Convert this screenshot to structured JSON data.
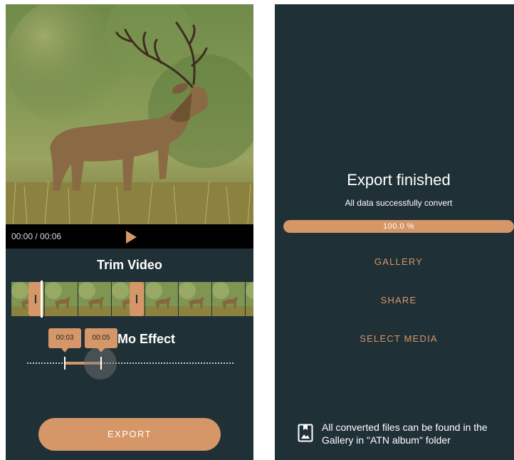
{
  "left_screen": {
    "video": {
      "time_display": "00:00 / 00:06"
    },
    "trim_title": "Trim Video",
    "slomo_title": "Slow Mo Effect",
    "slomo_start_label": "00:03",
    "slomo_end_label": "00:05",
    "export_label": "EXPORT"
  },
  "right_screen": {
    "title": "Export finished",
    "subtitle": "All data successfully convert",
    "progress": {
      "fraction": 1.0,
      "label": "100.0 %"
    },
    "actions": [
      "GALLERY",
      "SHARE",
      "SELECT MEDIA"
    ],
    "info_text": "All converted files can be found in the Gallery in \"ATN album\" folder"
  },
  "colors": {
    "background": "#1f3036",
    "accent": "#d59668",
    "video_bar": "#000000",
    "text": "#ffffff"
  },
  "icons": {
    "play": "play-icon",
    "gallery_info": "image-bookmark-icon"
  }
}
